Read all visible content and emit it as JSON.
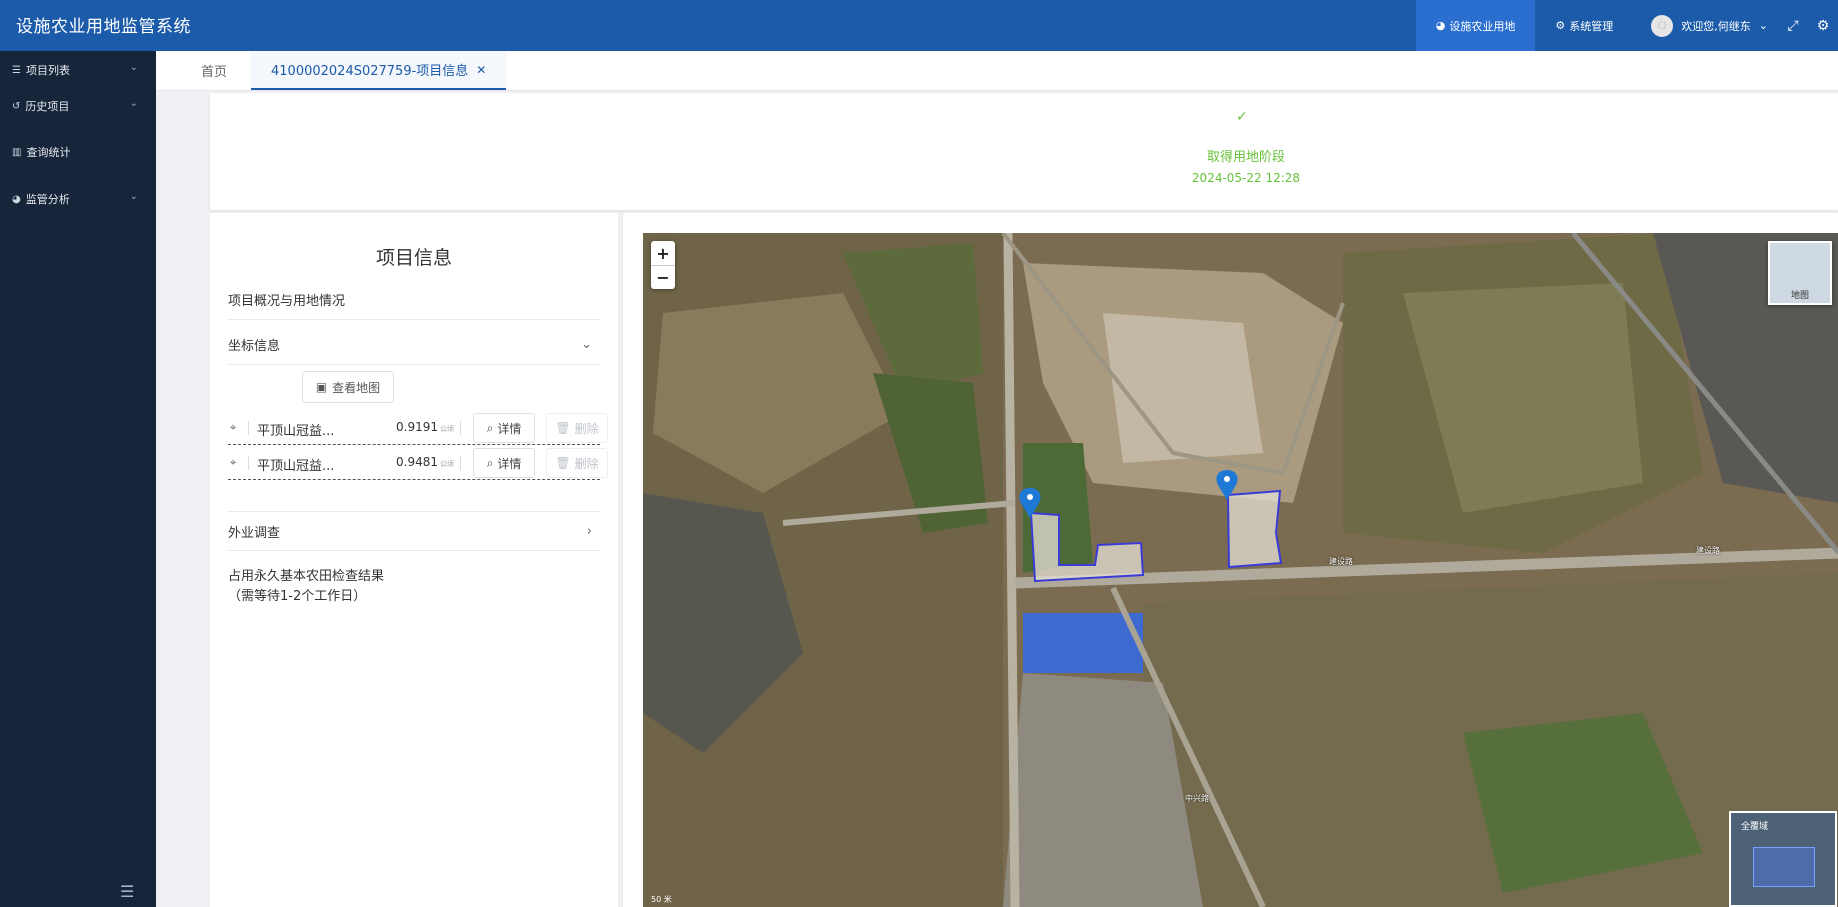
{
  "app": {
    "title": "设施农业用地监管系统"
  },
  "top_nav": {
    "items": [
      {
        "label": "设施农业用地",
        "icon": "pie-chart-icon",
        "active": true
      },
      {
        "label": "系统管理",
        "icon": "cog-icon",
        "active": false
      }
    ],
    "user": {
      "greeting": "欢迎您,何继东"
    }
  },
  "sidebar": {
    "items": [
      {
        "label": "项目列表",
        "icon": "list-icon",
        "has_children": true
      },
      {
        "label": "历史项目",
        "icon": "history-icon",
        "has_children": true
      },
      {
        "label": "查询统计",
        "icon": "bar-chart-icon",
        "has_children": false
      },
      {
        "label": "监管分析",
        "icon": "pie-chart-icon",
        "has_children": true
      }
    ]
  },
  "tabs": {
    "home": "首页",
    "active": "4100002024S027759-项目信息"
  },
  "stage": {
    "title": "取得用地阶段",
    "time": "2024-05-22 12:28",
    "color": "#67c23a"
  },
  "info": {
    "heading": "项目信息",
    "overview_label": "项目概况与用地情况",
    "coords_label": "坐标信息",
    "view_map_label": "查看地图",
    "coords": [
      {
        "name": "平顶山冠益...",
        "value": "0.9191",
        "unit": "公顷",
        "detail": "详情",
        "delete": "删除"
      },
      {
        "name": "平顶山冠益...",
        "value": "0.9481",
        "unit": "公顷",
        "detail": "详情",
        "delete": "删除"
      }
    ],
    "field_survey_label": "外业调查",
    "result_line1": "占用永久基本农田检查结果",
    "result_line2": "（需等待1-2个工作日）"
  },
  "map": {
    "zoom_in": "+",
    "zoom_out": "−",
    "layer_label": "地图",
    "overview_label": "全覆域",
    "road_labels": [
      "建设路",
      "建设路",
      "中兴路"
    ],
    "scale_label": "50 米",
    "polygon_color": "#3b3bd8"
  },
  "colors": {
    "header": "#1b5ba9",
    "sidebar": "#17253b",
    "accent": "#1b5ba9"
  }
}
